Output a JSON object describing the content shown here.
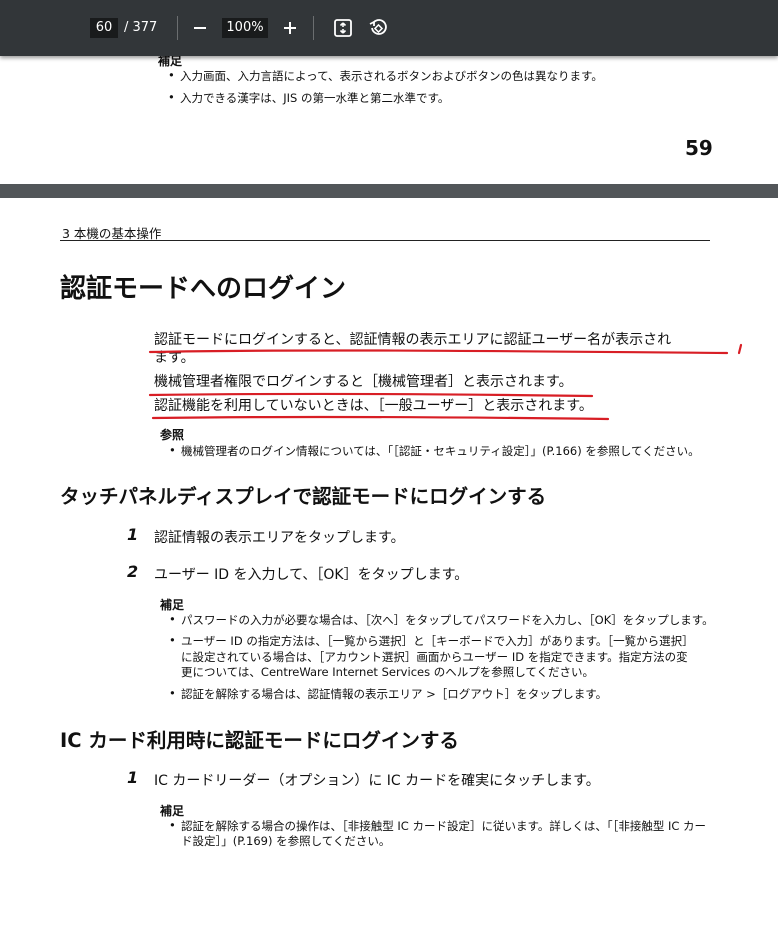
{
  "toolbar": {
    "current_page": "60",
    "total_pages": "/ 377",
    "zoom": "100%",
    "zoom_out_icon": "minus-icon",
    "zoom_in_icon": "plus-icon",
    "fit_icon": "fit-to-page-icon",
    "rotate_icon": "rotate-icon"
  },
  "page1": {
    "note_heading": "補足",
    "bullets": [
      "入力画面、入力言語によって、表示されるボタンおよびボタンの色は異なります。",
      "入力できる漢字は、JIS の第一水準と第二水準です。"
    ],
    "page_number": "59"
  },
  "page2": {
    "chapter": "3 本機の基本操作",
    "title": "認証モードへのログイン",
    "intro_lines": [
      "認証モードにログインすると、認証情報の表示エリアに認証ユーザー名が表示され",
      "ます。",
      "機械管理者権限でログインすると［機械管理者］と表示されます。",
      "認証機能を利用していないときは、［一般ユーザー］と表示されます。"
    ],
    "ref_heading": "参照",
    "ref_bullet": "機械管理者のログイン情報については、「［認証・セキュリティ設定］」(P.166) を参照してください。",
    "section1": {
      "heading": "タッチパネルディスプレイで認証モードにログインする",
      "steps": [
        {
          "num": "1",
          "text": "認証情報の表示エリアをタップします。"
        },
        {
          "num": "2",
          "text": "ユーザー ID を入力して、［OK］をタップします。"
        }
      ],
      "note_heading": "補足",
      "bullet1": "パスワードの入力が必要な場合は、［次へ］をタップしてパスワードを入力し、［OK］をタップします。",
      "bullet2_lines": [
        "ユーザー ID の指定方法は、［一覧から選択］と［キーボードで入力］があります。［一覧から選択］",
        "に設定されている場合は、［アカウント選択］画面からユーザー ID を指定できます。指定方法の変",
        "更については、CentreWare Internet Services のヘルプを参照してください。"
      ],
      "bullet3": "認証を解除する場合は、認証情報の表示エリア >［ログアウト］をタップします。"
    },
    "section2": {
      "heading": "IC カード利用時に認証モードにログインする",
      "step": {
        "num": "1",
        "text": "IC カードリーダー（オプション）に IC カードを確実にタッチします。"
      },
      "note_heading": "補足",
      "bullet_lines": [
        "認証を解除する場合の操作は、［非接触型 IC カード設定］に従います。詳しくは、「［非接触型 IC カー",
        "ド設定］」(P.169) を参照してください。"
      ]
    }
  },
  "colors": {
    "toolbar_bg": "#323639",
    "viewer_bg": "#525659",
    "annotation_red": "#d81e25"
  }
}
